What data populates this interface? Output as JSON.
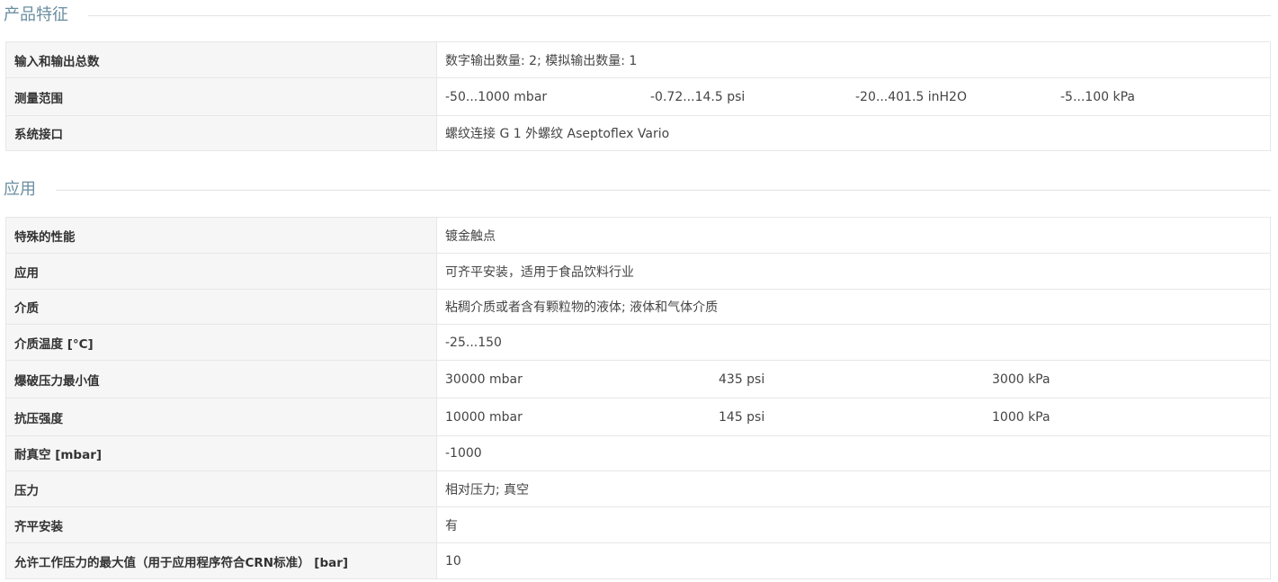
{
  "sections": [
    {
      "title": "产品特征",
      "rows": [
        {
          "label": "输入和输出总数",
          "values": [
            "数字输出数量: 2; 模拟输出数量: 1"
          ]
        },
        {
          "label": "测量范围",
          "values": [
            "-50...1000 mbar",
            "-0.72...14.5 psi",
            "-20...401.5 inH2O",
            "-5...100 kPa"
          ]
        },
        {
          "label": "系统接口",
          "values": [
            "螺纹连接 G 1 外螺纹 Aseptoflex Vario"
          ]
        }
      ]
    },
    {
      "title": "应用",
      "rows": [
        {
          "label": "特殊的性能",
          "values": [
            "镀金触点"
          ]
        },
        {
          "label": "应用",
          "values": [
            "可齐平安装，适用于食品饮料行业"
          ]
        },
        {
          "label": "介质",
          "values": [
            "粘稠介质或者含有颗粒物的液体; 液体和气体介质"
          ]
        },
        {
          "label": "介质温度 [°C]",
          "values": [
            "-25...150"
          ]
        },
        {
          "label": "爆破压力最小值",
          "values": [
            "30000 mbar",
            "435 psi",
            "3000 kPa"
          ]
        },
        {
          "label": "抗压强度",
          "values": [
            "10000 mbar",
            "145 psi",
            "1000 kPa"
          ]
        },
        {
          "label": "耐真空 [mbar]",
          "values": [
            "-1000"
          ]
        },
        {
          "label": "压力",
          "values": [
            "相对压力; 真空"
          ]
        },
        {
          "label": "齐平安装",
          "values": [
            "有"
          ]
        },
        {
          "label": "允许工作压力的最大值（用于应用程序符合CRN标准） [bar]",
          "values": [
            "10"
          ]
        }
      ]
    }
  ],
  "colors": {
    "section_title": "#6a8ea0",
    "label_bg": "#f6f6f6",
    "border": "#e7e7e7"
  }
}
